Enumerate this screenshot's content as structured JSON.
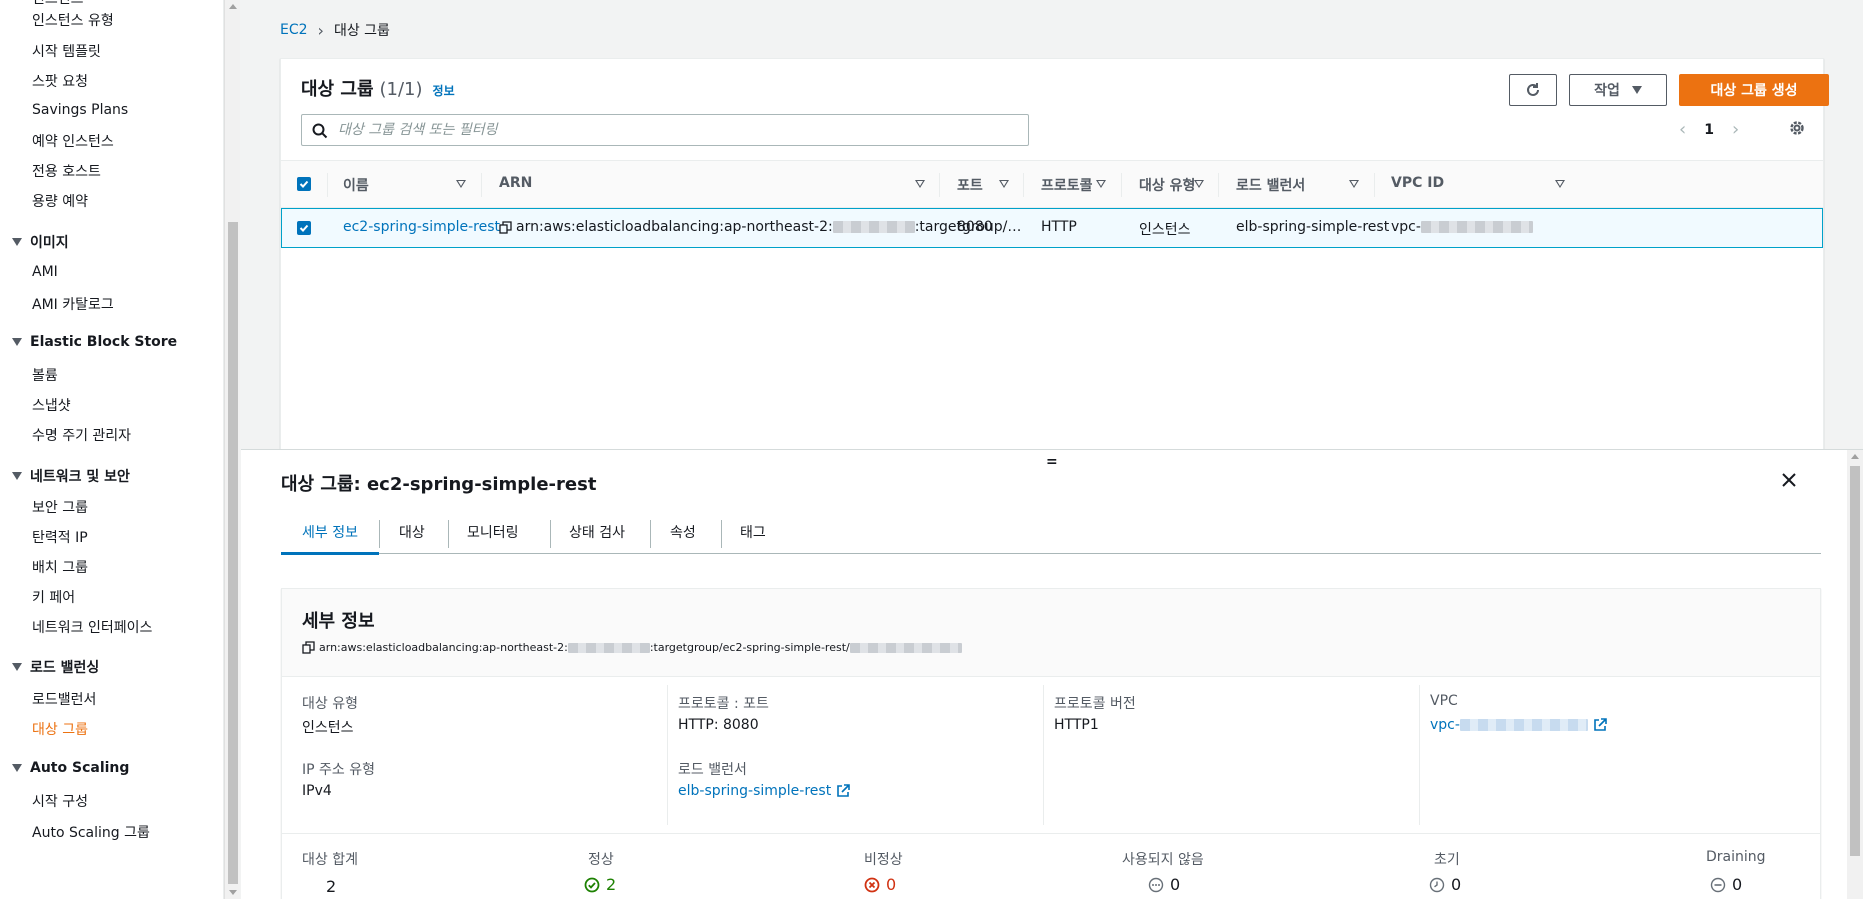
{
  "sidebar": {
    "items_top": [
      "인스턴스",
      "인스턴스 유형",
      "시작 템플릿",
      "스팟 요청",
      "Savings Plans",
      "예약 인스턴스",
      "전용 호스트",
      "용량 예약"
    ],
    "sections": [
      {
        "title": "이미지",
        "items": [
          "AMI",
          "AMI 카탈로그"
        ]
      },
      {
        "title": "Elastic Block Store",
        "items": [
          "볼륨",
          "스냅샷",
          "수명 주기 관리자"
        ]
      },
      {
        "title": "네트워크 및 보안",
        "items": [
          "보안 그룹",
          "탄력적 IP",
          "배치 그룹",
          "키 페어",
          "네트워크 인터페이스"
        ]
      },
      {
        "title": "로드 밸런싱",
        "items": [
          "로드밸런서",
          "대상 그룹"
        ]
      },
      {
        "title": "Auto Scaling",
        "items": [
          "시작 구성",
          "Auto Scaling 그룹"
        ]
      }
    ],
    "active_item": "대상 그룹"
  },
  "breadcrumb": {
    "root": "EC2",
    "current": "대상 그룹"
  },
  "panel": {
    "title": "대상 그룹",
    "count": "(1/1)",
    "info": "정보",
    "actions_label": "작업",
    "create_label": "대상 그룹 생성",
    "search_placeholder": "대상 그룹 검색 또는 필터링",
    "page": "1"
  },
  "table": {
    "headers": [
      "이름",
      "ARN",
      "포트",
      "프로토콜",
      "대상 유형",
      "로드 밸런서",
      "VPC ID"
    ],
    "row": {
      "name": "ec2-spring-simple-rest",
      "arn_prefix": "arn:aws:elasticloadbalancing:ap-northeast-2:",
      "arn_suffix": ":targetgroup/…",
      "port": "8080",
      "protocol": "HTTP",
      "target_type": "인스턴스",
      "load_balancer": "elb-spring-simple-rest",
      "vpc_prefix": "vpc-"
    }
  },
  "split": {
    "title": "대상 그룹: ec2-spring-simple-rest",
    "tabs": [
      "세부 정보",
      "대상",
      "모니터링",
      "상태 검사",
      "속성",
      "태그"
    ],
    "detail": {
      "title": "세부 정보",
      "arn_prefix": "arn:aws:elasticloadbalancing:ap-northeast-2:",
      "arn_mid": ":targetgroup/ec2-spring-simple-rest/",
      "target_type_label": "대상 유형",
      "target_type_value": "인스턴스",
      "protocol_port_label": "프로토콜 : 포트",
      "protocol_port_value": "HTTP: 8080",
      "protocol_version_label": "프로토콜 버전",
      "protocol_version_value": "HTTP1",
      "vpc_label": "VPC",
      "vpc_prefix": "vpc-",
      "ip_type_label": "IP 주소 유형",
      "ip_type_value": "IPv4",
      "lb_label": "로드 밸런서",
      "lb_value": "elb-spring-simple-rest"
    },
    "stats": [
      {
        "label": "대상 합계",
        "value": "2"
      },
      {
        "label": "정상",
        "value": "2"
      },
      {
        "label": "비정상",
        "value": "0"
      },
      {
        "label": "사용되지 않음",
        "value": "0"
      },
      {
        "label": "초기",
        "value": "0"
      },
      {
        "label": "Draining",
        "value": "0"
      }
    ]
  },
  "colors": {
    "accent": "#ec7211",
    "link": "#0073bb",
    "healthy": "#1d8102",
    "unhealthy": "#d13212"
  }
}
